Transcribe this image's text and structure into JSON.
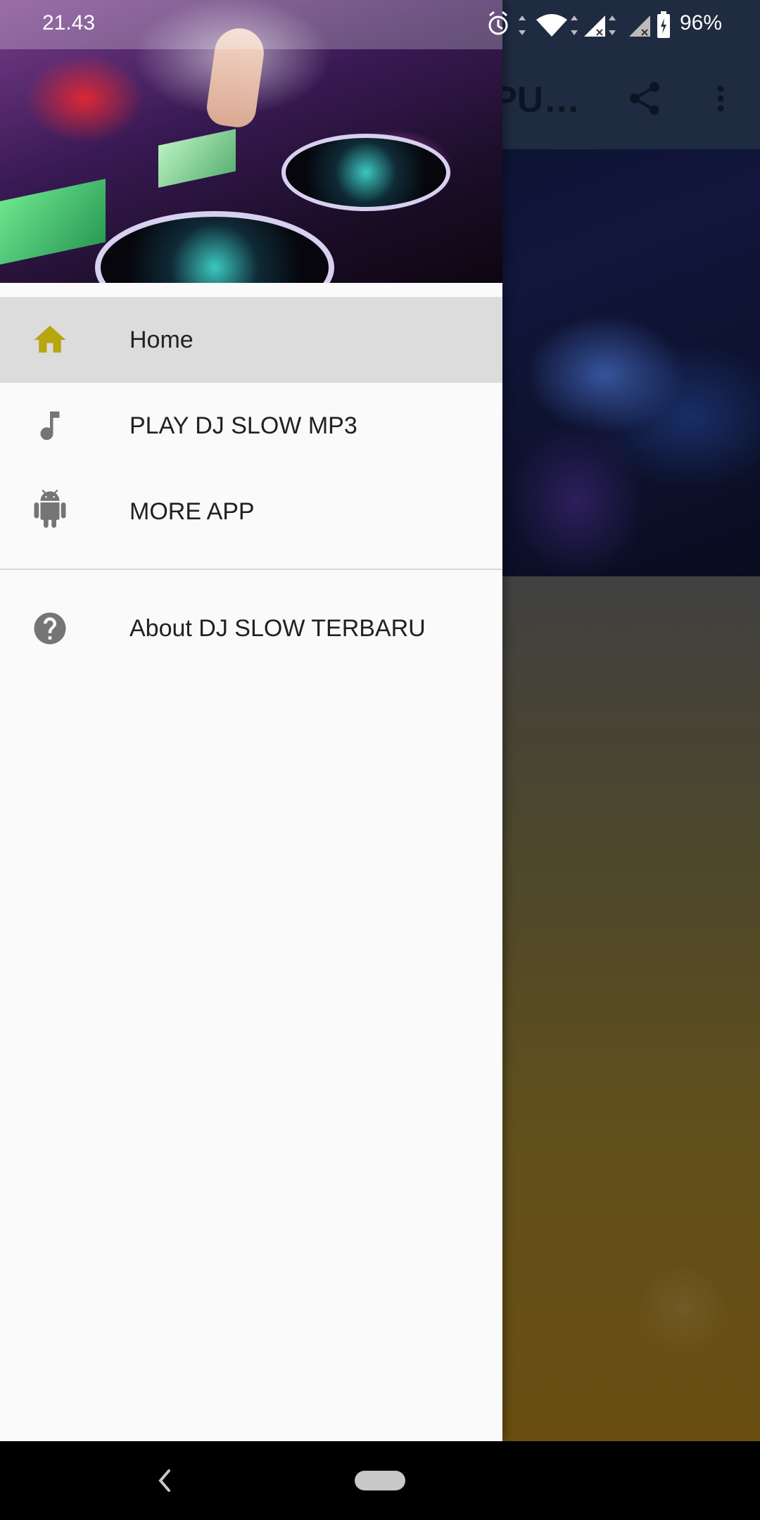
{
  "status_bar": {
    "time": "21.43",
    "battery_percent": "96%",
    "icons": [
      "alarm-icon",
      "wifi-icon",
      "signal-icon",
      "signal-icon-2",
      "battery-charging-icon"
    ]
  },
  "app": {
    "toolbar_title_partial": "PU…",
    "toolbar_color": "#24324a",
    "actions": [
      "share-icon",
      "more-vert-icon"
    ]
  },
  "drawer": {
    "menu": [
      {
        "label": "Home",
        "icon": "home-icon",
        "active": true,
        "icon_color": "#b6a60f"
      },
      {
        "label": "PLAY DJ SLOW MP3",
        "icon": "music-note-icon",
        "active": false,
        "icon_color": "#757575"
      },
      {
        "label": "MORE APP",
        "icon": "android-icon",
        "active": false,
        "icon_color": "#757575"
      }
    ],
    "secondary": [
      {
        "label": "About DJ SLOW TERBARU",
        "icon": "help-circle-icon",
        "icon_color": "#757575"
      }
    ]
  },
  "nav_bar": {
    "buttons": [
      "back-icon",
      "home-pill"
    ]
  }
}
